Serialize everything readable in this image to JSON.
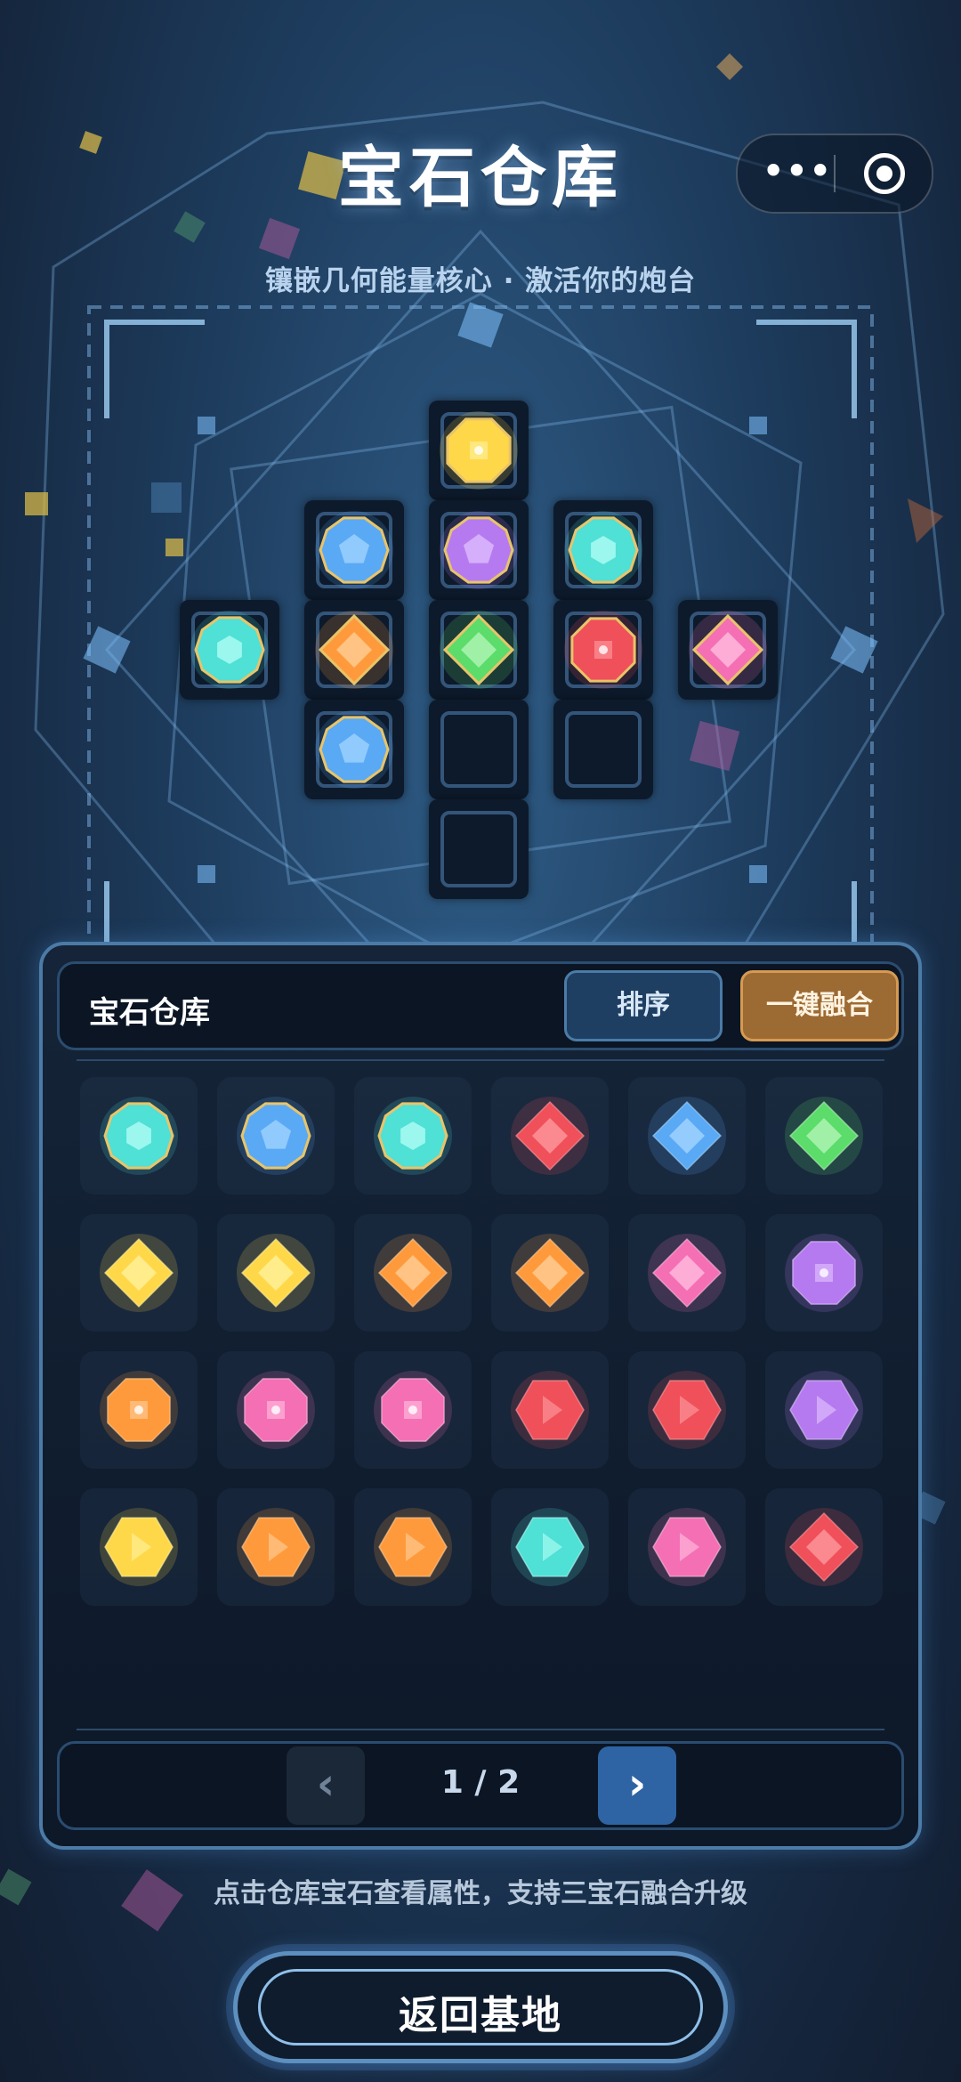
{
  "header": {
    "title": "宝石仓库",
    "subtitle": "镶嵌几何能量核心 · 激活你的炮台",
    "menu_button_icon": "more-dots-icon",
    "close_button_icon": "target-circle-icon"
  },
  "colors": {
    "background": "#1d3b5c",
    "panel_border": "#4b7ba6",
    "sort_button": "#1e3e62",
    "fuse_button": "#9c6a33",
    "next_button": "#2e64a3",
    "empty_slot_border": "#34557a"
  },
  "socket_board": {
    "slots": [
      {
        "gem": "yellow-octagon"
      },
      {
        "gem": "blue-pentagon"
      },
      {
        "gem": "purple-pentagon"
      },
      {
        "gem": "cyan-hexagon"
      },
      {
        "gem": "cyan-hexagon"
      },
      {
        "gem": "orange-diamond"
      },
      {
        "gem": "green-diamond"
      },
      {
        "gem": "red-octagon"
      },
      {
        "gem": "pink-diamond"
      },
      {
        "gem": "blue-pentagon"
      },
      {
        "gem": "empty"
      },
      {
        "gem": "empty"
      },
      {
        "gem": "empty"
      }
    ]
  },
  "warehouse": {
    "title": "宝石仓库",
    "sort_label": "排序",
    "fuse_label": "一键融合",
    "gems": [
      "cyan-hexagon",
      "blue-pentagon",
      "cyan-hexagon",
      "red-diamond",
      "blue-diamond",
      "green-diamond",
      "yellow-diamond",
      "yellow-diamond",
      "orange-diamond",
      "orange-diamond",
      "pink-diamond",
      "purple-octagon",
      "orange-octagon",
      "pink-octagon",
      "pink-octagon",
      "red-hexagon",
      "red-hexagon",
      "purple-hexagon",
      "yellow-hexagon",
      "orange-hexagon",
      "orange-hexagon",
      "cyan-hexagon",
      "pink-hexagon",
      "red-diamond"
    ]
  },
  "pager": {
    "prev_label": "‹",
    "page_text": "1 / 2",
    "next_label": "›"
  },
  "footer": {
    "tip": "点击仓库宝石查看属性，支持三宝石融合升级",
    "back_label": "返回基地"
  }
}
